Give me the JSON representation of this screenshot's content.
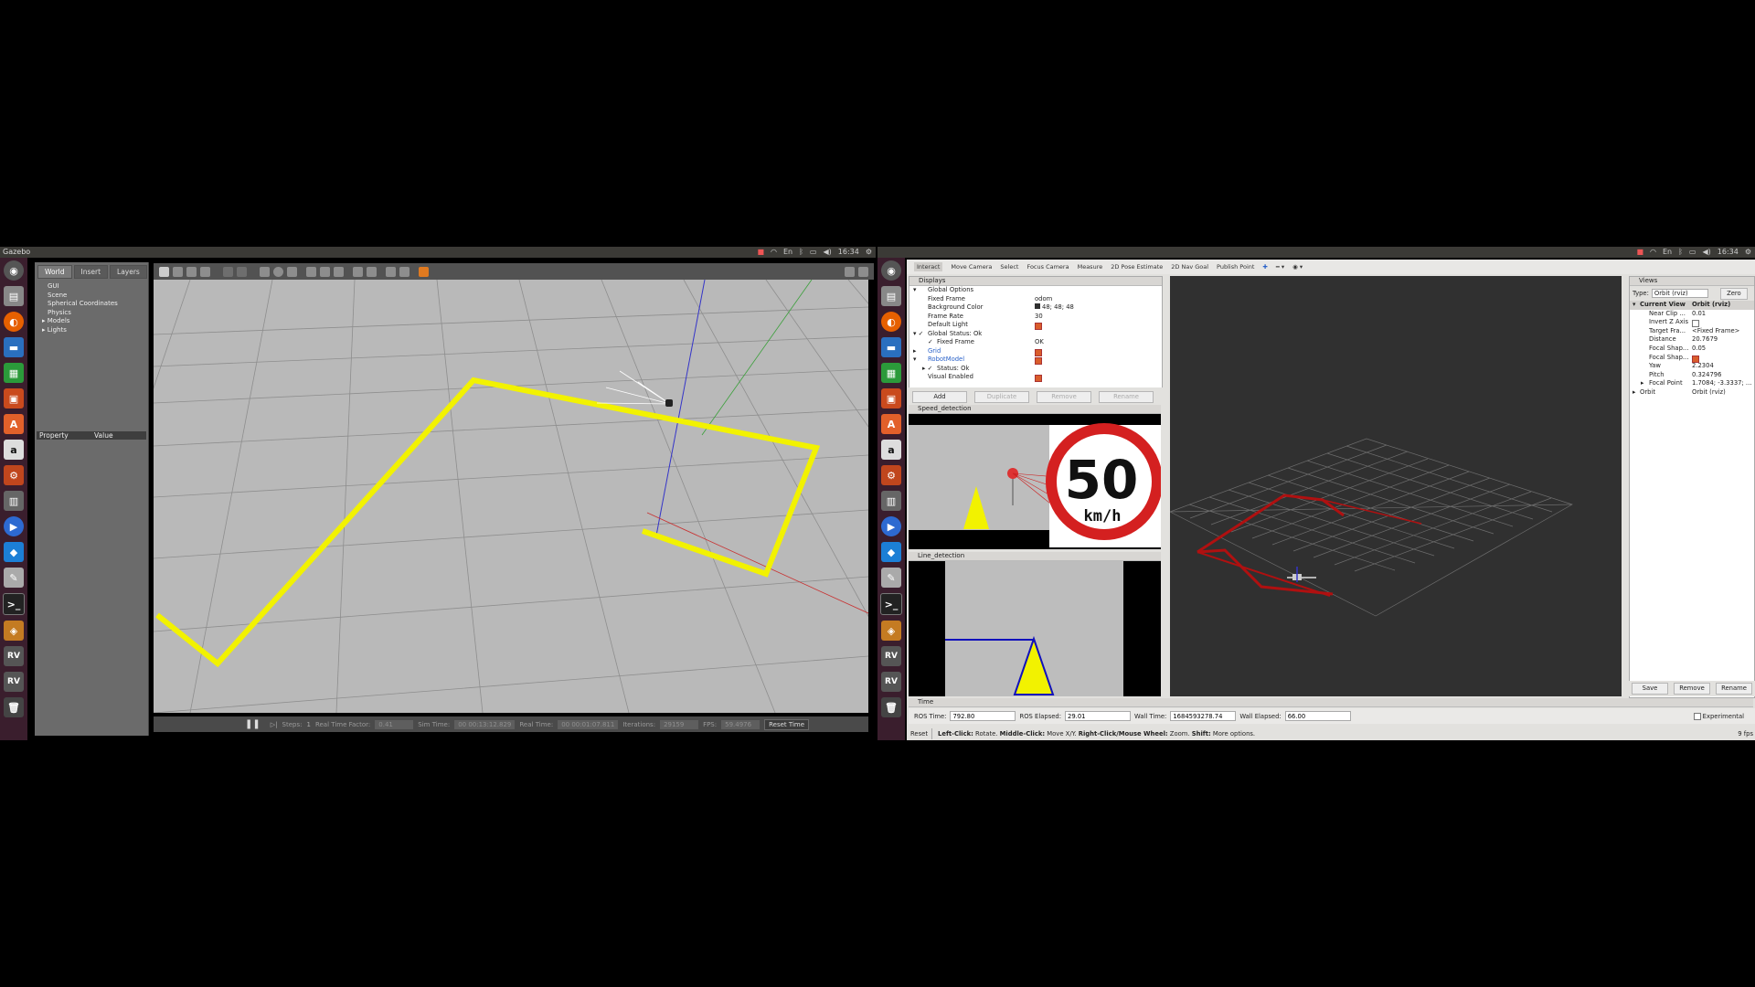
{
  "screen_left": {
    "app_title": "Gazebo",
    "clock": "16:34",
    "keyboard": "En"
  },
  "screen_right": {
    "clock": "16:34",
    "keyboard": "En"
  },
  "gazebo": {
    "tabs": [
      "World",
      "Insert",
      "Layers"
    ],
    "world_tree": [
      "GUI",
      "Scene",
      "Spherical Coordinates",
      "Physics",
      "Models",
      "Lights"
    ],
    "prop_headers": [
      "Property",
      "Value"
    ],
    "status": {
      "steps_label": "Steps:",
      "steps_value": "1",
      "rtf_label": "Real Time Factor:",
      "rtf_value": "0.41",
      "sim_label": "Sim Time:",
      "sim_value": "00 00:13:12.829",
      "real_label": "Real Time:",
      "real_value": "00 00:01:07.811",
      "iter_label": "Iterations:",
      "iter_value": "29159",
      "fps_label": "FPS:",
      "fps_value": "59.4976",
      "reset_label": "Reset Time"
    }
  },
  "rviz": {
    "toolbar": [
      "Interact",
      "Move Camera",
      "Select",
      "Focus Camera",
      "Measure",
      "2D Pose Estimate",
      "2D Nav Goal",
      "Publish Point"
    ],
    "displays_title": "Displays",
    "displays": [
      {
        "k": "Global Options",
        "v": ""
      },
      {
        "k": "Fixed Frame",
        "v": "odom"
      },
      {
        "k": "Background Color",
        "v": "48; 48; 48"
      },
      {
        "k": "Frame Rate",
        "v": "30"
      },
      {
        "k": "Default Light",
        "v": ""
      },
      {
        "k": "Global Status: Ok",
        "v": ""
      },
      {
        "k": "Fixed Frame",
        "v": "OK"
      },
      {
        "k": "Grid",
        "v": ""
      },
      {
        "k": "RobotModel",
        "v": ""
      },
      {
        "k": "Status: Ok",
        "v": ""
      },
      {
        "k": "Visual Enabled",
        "v": ""
      }
    ],
    "display_buttons": [
      "Add",
      "Duplicate",
      "Remove",
      "Rename"
    ],
    "speed_panel_title": "Speed_detection",
    "sign_number": "50",
    "sign_unit": "km/h",
    "line_panel_title": "Line_detection",
    "views_title": "Views",
    "views_type_label": "Type:",
    "views_type_value": "Orbit (rviz)",
    "views_zero": "Zero",
    "views": [
      {
        "k": "Current View",
        "v": "Orbit (rviz)"
      },
      {
        "k": "Near Clip ...",
        "v": "0.01"
      },
      {
        "k": "Invert Z Axis",
        "v": ""
      },
      {
        "k": "Target Fra...",
        "v": "<Fixed Frame>"
      },
      {
        "k": "Distance",
        "v": "20.7679"
      },
      {
        "k": "Focal Shap...",
        "v": "0.05"
      },
      {
        "k": "Focal Shap...",
        "v": ""
      },
      {
        "k": "Yaw",
        "v": "2.2304"
      },
      {
        "k": "Pitch",
        "v": "0.324796"
      },
      {
        "k": "Focal Point",
        "v": "1.7084; -3.3337; ..."
      },
      {
        "k": "Orbit",
        "v": "Orbit (rviz)"
      }
    ],
    "views_buttons": [
      "Save",
      "Remove",
      "Rename"
    ],
    "time_title": "Time",
    "ros_time_label": "ROS Time:",
    "ros_time": "792.80",
    "ros_elapsed_label": "ROS Elapsed:",
    "ros_elapsed": "29.01",
    "wall_time_label": "Wall Time:",
    "wall_time": "1684593278.74",
    "wall_elapsed_label": "Wall Elapsed:",
    "wall_elapsed": "66.00",
    "experimental": "Experimental",
    "reset": "Reset",
    "hint_left": "Left-Click:",
    "hint_left_t": " Rotate. ",
    "hint_mid": "Middle-Click:",
    "hint_mid_t": " Move X/Y. ",
    "hint_right": "Right-Click/Mouse Wheel:",
    "hint_right_t": " Zoom. ",
    "hint_shift": "Shift:",
    "hint_shift_t": " More options.",
    "fps": "9 fps"
  }
}
